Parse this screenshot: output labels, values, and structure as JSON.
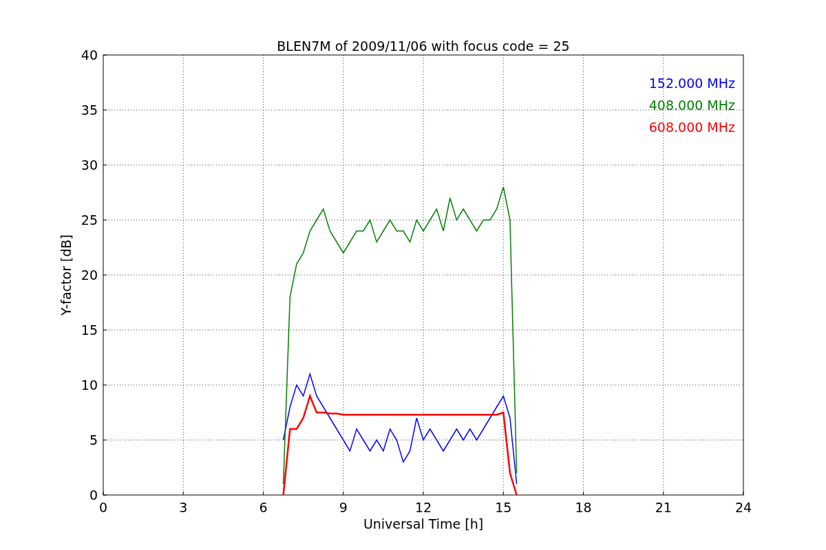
{
  "figure": {
    "chart_data": {
      "type": "line",
      "title": "BLEN7M of 2009/11/06 with focus code = 25",
      "xlabel": "Universal Time [h]",
      "ylabel": "Y-factor [dB]",
      "x": [
        6.75,
        7,
        7.25,
        7.5,
        7.75,
        8,
        8.25,
        8.5,
        8.75,
        9,
        9.25,
        9.5,
        9.75,
        10,
        10.25,
        10.5,
        10.75,
        11,
        11.25,
        11.5,
        11.75,
        12,
        12.25,
        12.5,
        12.75,
        13,
        13.25,
        13.5,
        13.75,
        14,
        14.25,
        14.5,
        14.75,
        15,
        15.25,
        15.5
      ],
      "series": [
        {
          "name": "152.000 MHz",
          "color": "#0000ff",
          "values": [
            5,
            8,
            10,
            9,
            11,
            9,
            8,
            7,
            6,
            5,
            4,
            6,
            5,
            4,
            5,
            4,
            6,
            5,
            3,
            4,
            7,
            5,
            6,
            5,
            4,
            5,
            6,
            5,
            6,
            5,
            6,
            7,
            8,
            9,
            7,
            1
          ]
        },
        {
          "name": "408.000 MHz",
          "color": "#008000",
          "values": [
            1,
            18,
            21,
            22,
            24,
            25,
            26,
            24,
            23,
            22,
            23,
            24,
            24,
            25,
            23,
            24,
            25,
            24,
            24,
            23,
            25,
            24,
            25,
            26,
            24,
            27,
            25,
            26,
            25,
            24,
            25,
            25,
            26,
            28,
            25,
            2
          ]
        },
        {
          "name": "608.000 MHz",
          "color": "#ff0000",
          "values": [
            0,
            6,
            6,
            7,
            9,
            7.5,
            7.5,
            7.4,
            7.4,
            7.3,
            7.3,
            7.3,
            7.3,
            7.3,
            7.3,
            7.3,
            7.3,
            7.3,
            7.3,
            7.3,
            7.3,
            7.3,
            7.3,
            7.3,
            7.3,
            7.3,
            7.3,
            7.3,
            7.3,
            7.3,
            7.3,
            7.3,
            7.3,
            7.5,
            2,
            0
          ]
        }
      ],
      "xlim": [
        0,
        24
      ],
      "ylim": [
        0,
        40
      ],
      "xticks": [
        0,
        3,
        6,
        9,
        12,
        15,
        18,
        21,
        24
      ],
      "yticks": [
        0,
        5,
        10,
        15,
        20,
        25,
        30,
        35,
        40
      ],
      "grid": true
    }
  }
}
